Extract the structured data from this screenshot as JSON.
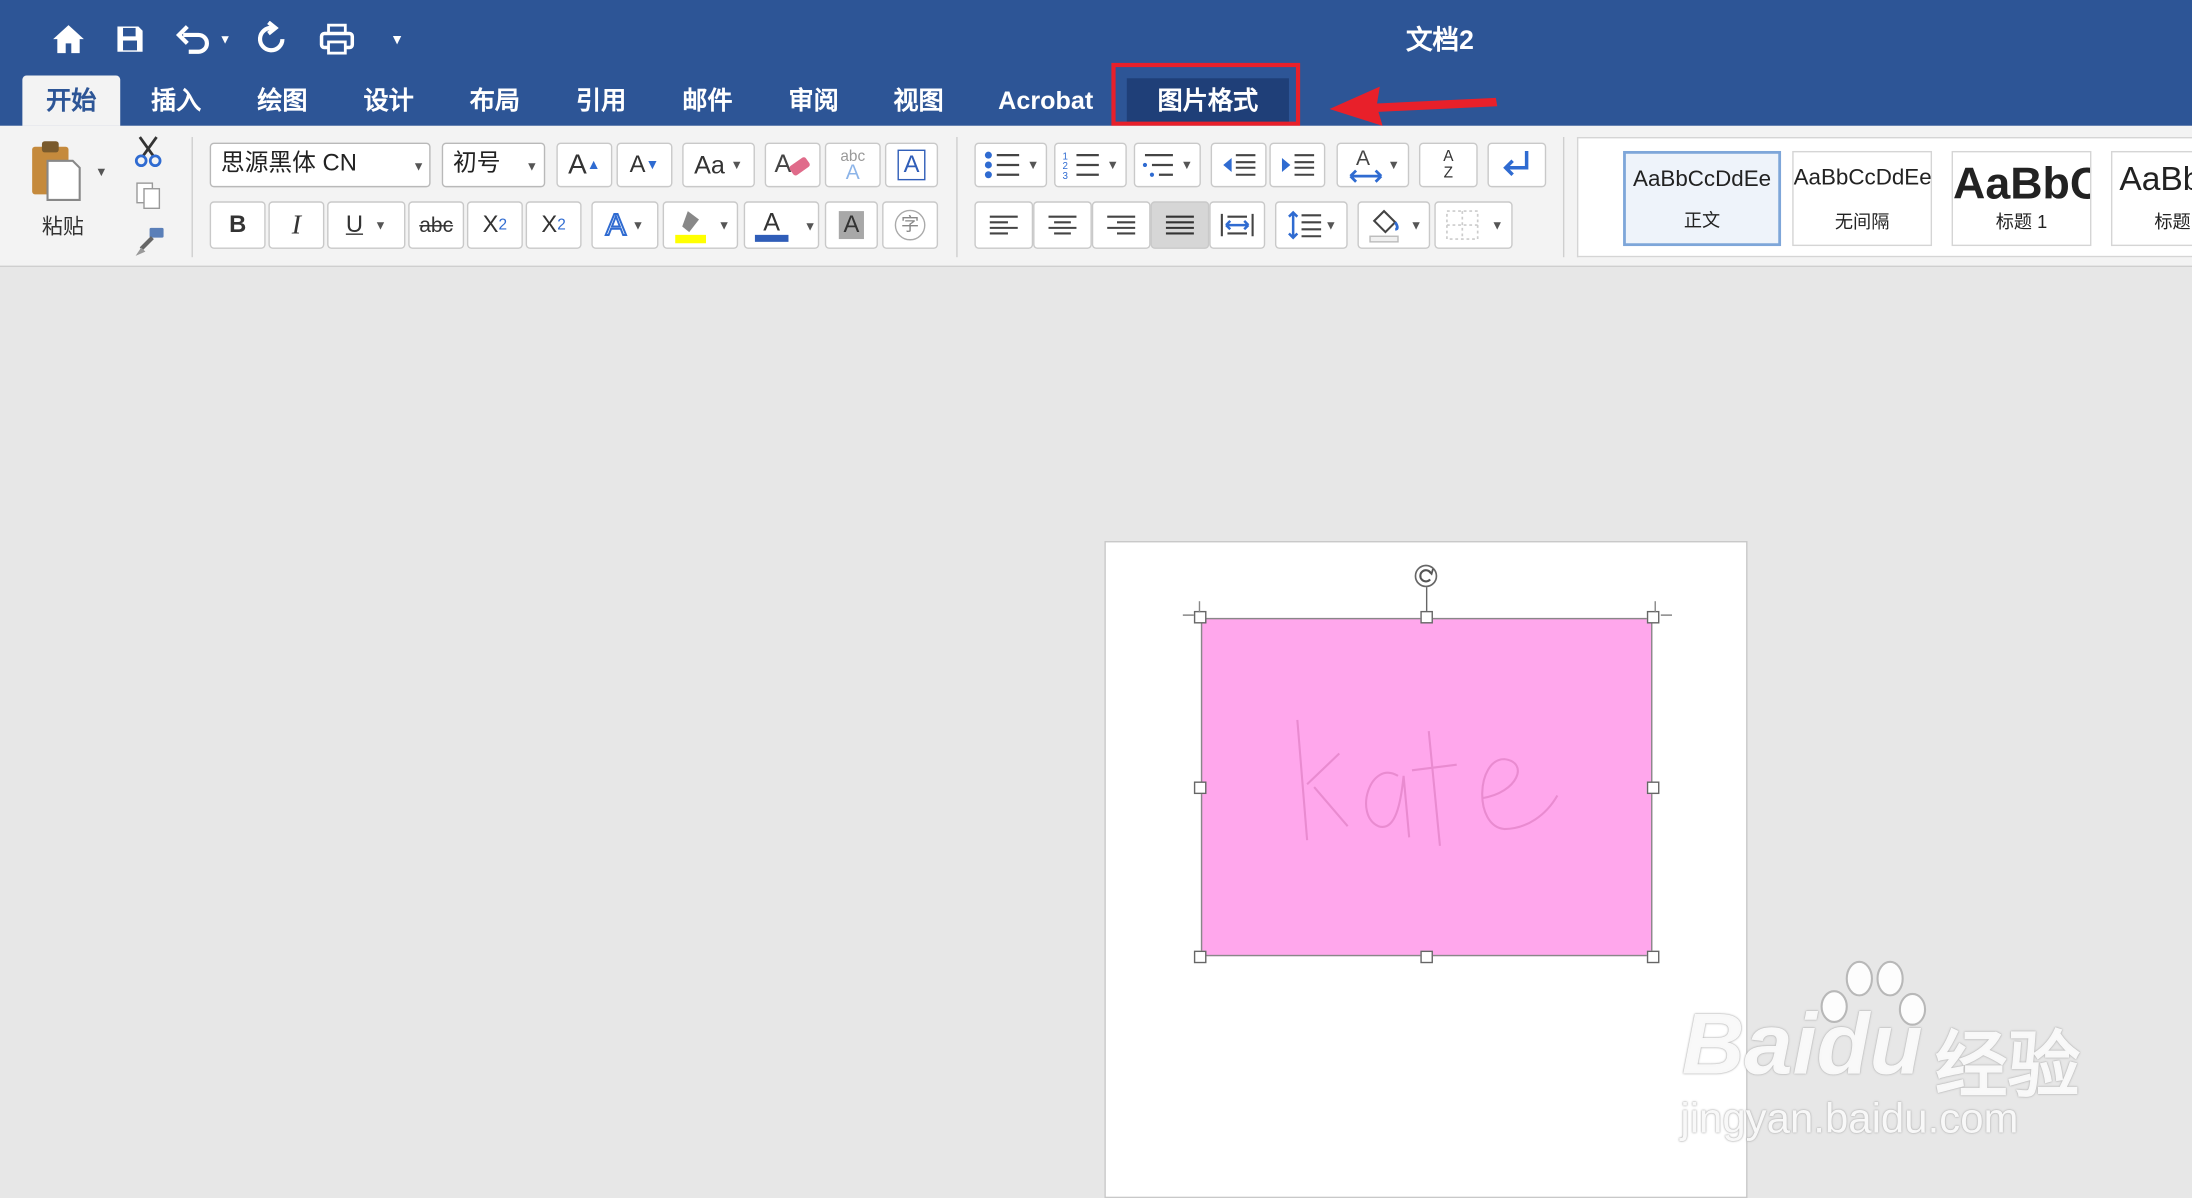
{
  "window": {
    "title": "文档2"
  },
  "quick_access": [
    "home-icon",
    "save-icon",
    "undo-icon",
    "redo-icon",
    "print-icon",
    "customize-icon"
  ],
  "tabs": [
    {
      "label": "开始",
      "active": true
    },
    {
      "label": "插入"
    },
    {
      "label": "绘图"
    },
    {
      "label": "设计"
    },
    {
      "label": "布局"
    },
    {
      "label": "引用"
    },
    {
      "label": "邮件"
    },
    {
      "label": "审阅"
    },
    {
      "label": "视图"
    },
    {
      "label": "Acrobat"
    },
    {
      "label": "图片格式",
      "highlighted": true
    }
  ],
  "ribbon": {
    "paste_label": "粘贴",
    "font_name": "思源黑体 CN",
    "font_size": "初号",
    "bold": "B",
    "italic": "I",
    "underline": "U",
    "strike": "abc",
    "sub": "X",
    "sub_mark": "2",
    "sup": "X",
    "sup_mark": "2",
    "grow": "A",
    "shrink": "A",
    "change_case": "Aa",
    "abc": "abc",
    "abc_a": "A",
    "textbox_a": "A",
    "effects_a": "A",
    "fontcolor_a": "A",
    "shading_a": "A",
    "phonetic": "字",
    "sort_az": "A",
    "sort_z": "Z"
  },
  "styles": [
    {
      "sample": "AaBbCcDdEe",
      "label": "正文",
      "selected": true
    },
    {
      "sample": "AaBbCcDdEe",
      "label": "无间隔"
    },
    {
      "sample": "AaBbC",
      "label": "标题 1"
    },
    {
      "sample": "AaBb",
      "label": "标题"
    }
  ],
  "document": {
    "image_text": "kate",
    "image_color": "#ffa7ec"
  },
  "watermark": {
    "brand": "Bai",
    "brand2": "du",
    "brand_cn": "经验",
    "url": "jingyan.baidu.com"
  },
  "colors": {
    "titlebar": "#2d5596",
    "highlight_box": "#e8202a",
    "highlighter": "#ffff00",
    "font_color": "#2f5db8"
  }
}
